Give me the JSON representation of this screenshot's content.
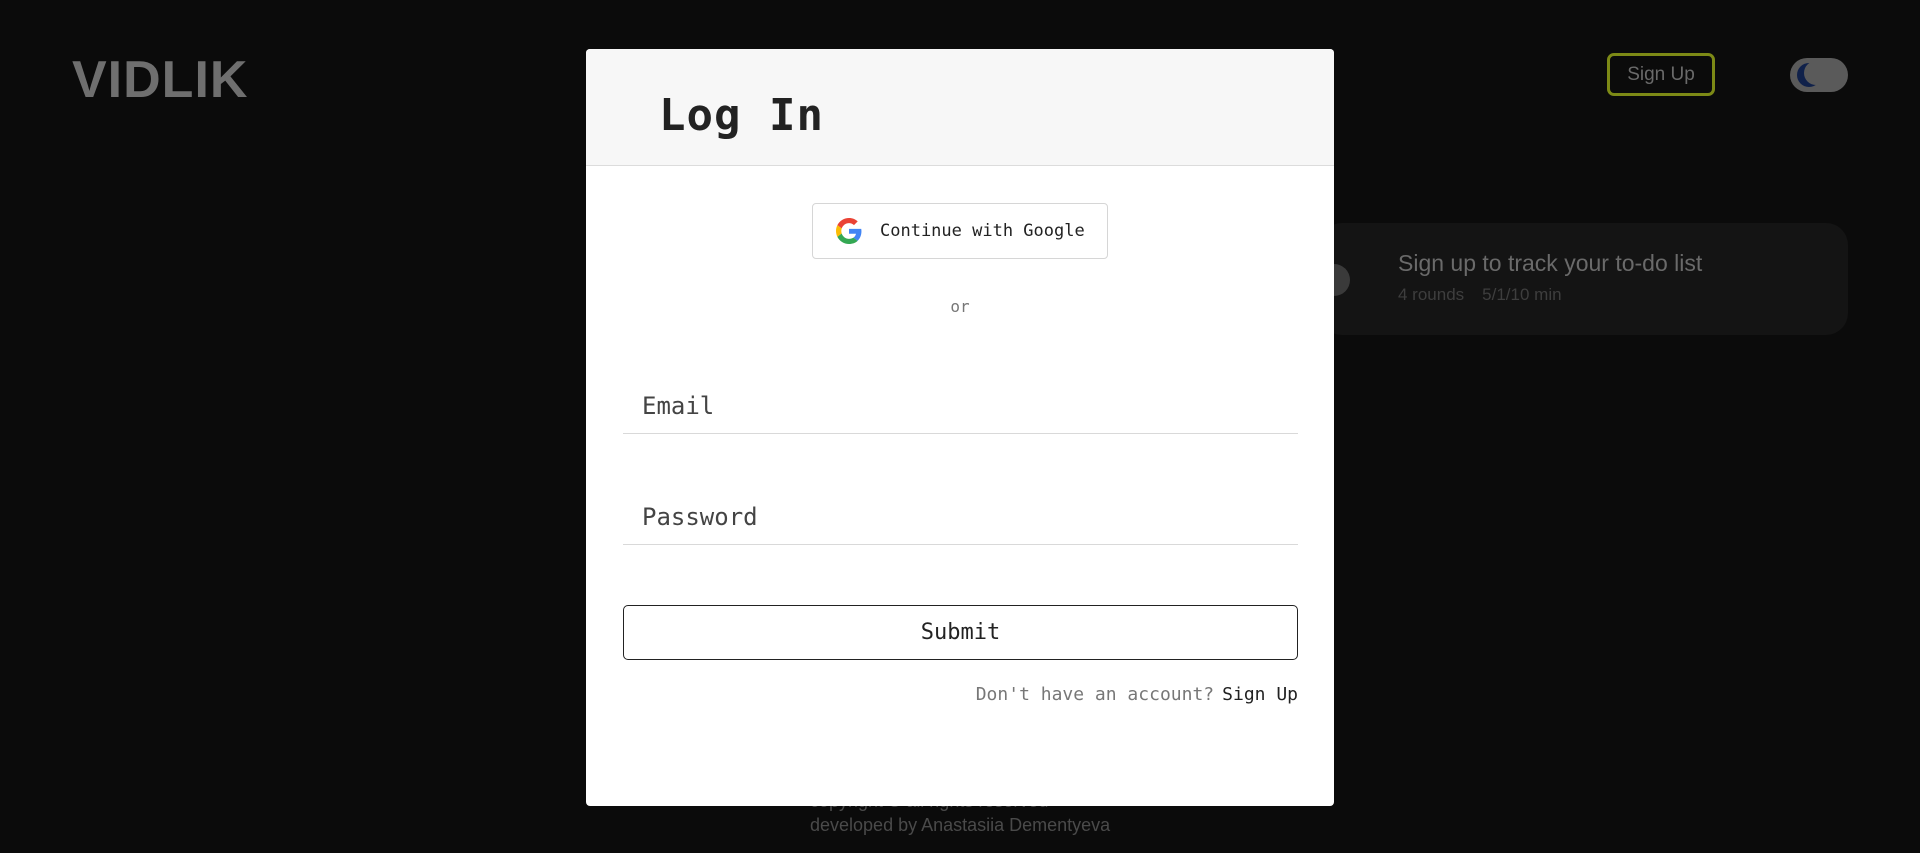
{
  "header": {
    "logo": "VIDLIK",
    "signup_label": "Sign Up"
  },
  "task_card": {
    "title": "Sign up to track your to-do list",
    "rounds": "4 rounds",
    "durations": "5/1/10 min"
  },
  "footer": {
    "line1": "copyright © all rights reserved",
    "line2": "developed by Anastasiia Dementyeva"
  },
  "modal": {
    "title": "Log In",
    "google_label": "Continue with Google",
    "or_text": "or",
    "email_placeholder": "Email",
    "password_placeholder": "Password",
    "submit_label": "Submit",
    "signup_prompt": "Don't have an account?",
    "signup_link": "Sign Up"
  },
  "colors": {
    "background": "#0b0b0b",
    "accent_border": "#7d8a16",
    "modal_bg": "#ffffff",
    "modal_header_bg": "#f7f7f7"
  },
  "icons": {
    "google": "google-logo-icon",
    "theme": "moon-icon"
  }
}
